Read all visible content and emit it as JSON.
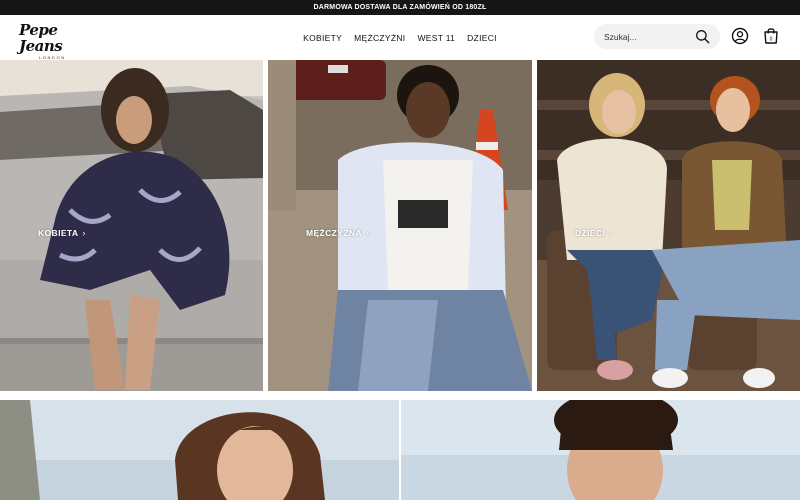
{
  "topbar": {
    "promo": "DARMOWA DOSTAWA DLA ZAMÓWIEŃ OD 180ZŁ"
  },
  "header": {
    "logo_main": "Pepe Jeans",
    "logo_sub": "LONDON",
    "nav": [
      {
        "label": "KOBIETY"
      },
      {
        "label": "MĘŻCZYŹNI"
      },
      {
        "label": "WEST 11"
      },
      {
        "label": "DZIECI"
      }
    ],
    "search_placeholder": "Szukaj...",
    "icons": [
      "search-icon",
      "user-icon",
      "cart-icon"
    ]
  },
  "tiles": [
    {
      "label": "KOBIETA",
      "chevron": "›"
    },
    {
      "label": "MĘŻCZYZNA",
      "chevron": "›"
    },
    {
      "label": "DZIECI",
      "chevron": "›"
    }
  ],
  "colors": {
    "topbar": "#161616",
    "search_bg": "#f2f2f2"
  }
}
